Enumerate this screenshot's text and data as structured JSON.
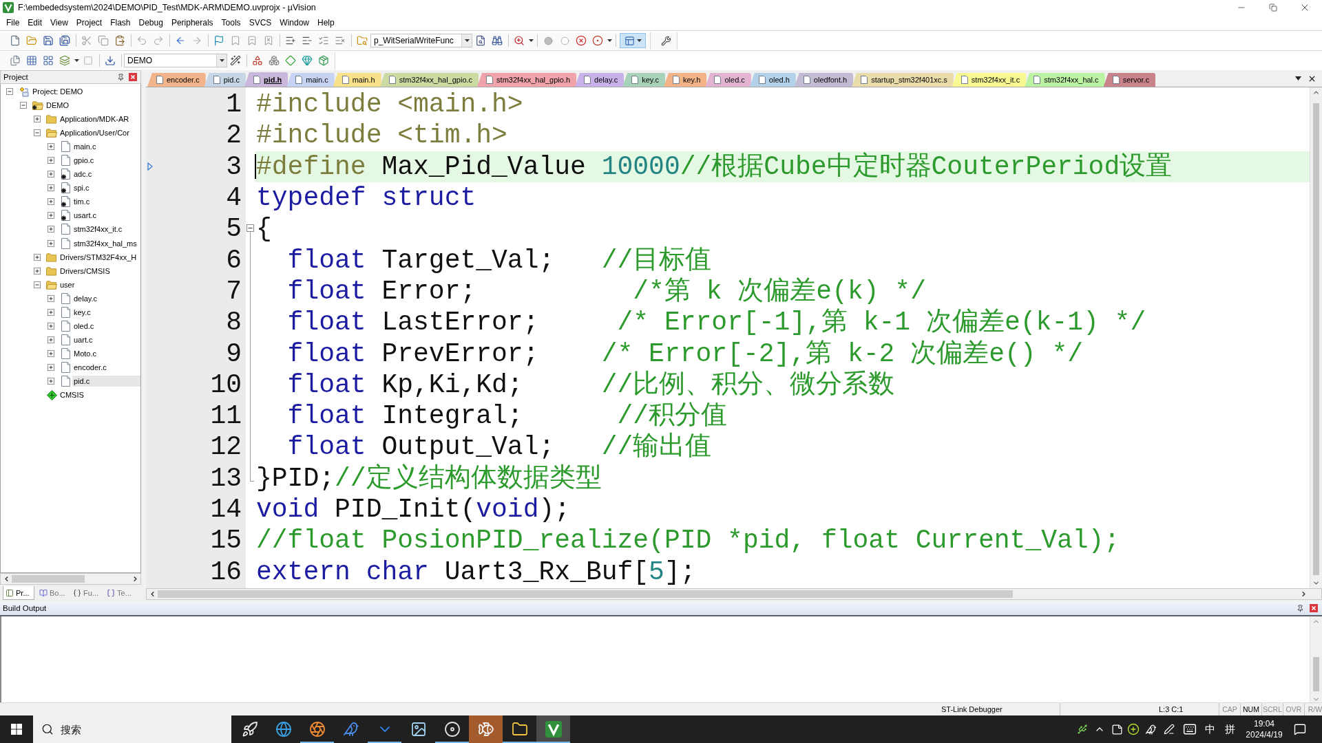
{
  "window": {
    "title": "F:\\embededsystem\\2024\\DEMO\\PID_Test\\MDK-ARM\\DEMO.uvprojx - µVision"
  },
  "menu": [
    "File",
    "Edit",
    "View",
    "Project",
    "Flash",
    "Debug",
    "Peripherals",
    "Tools",
    "SVCS",
    "Window",
    "Help"
  ],
  "toolbar": {
    "function_field": "p_WitSerialWriteFunc",
    "target_field": "DEMO"
  },
  "project_panel": {
    "title": "Project",
    "tree": [
      {
        "label": "Project: DEMO",
        "kind": "project",
        "expanded": true,
        "selected": false,
        "children": [
          {
            "label": "DEMO",
            "kind": "target",
            "expanded": true,
            "selected": false,
            "children": [
              {
                "label": "Application/MDK-AR",
                "kind": "group",
                "expanded": false,
                "selected": false
              },
              {
                "label": "Application/User/Cor",
                "kind": "group",
                "expanded": true,
                "selected": false,
                "children": [
                  {
                    "label": "main.c",
                    "kind": "file",
                    "expanded": false,
                    "selected": false
                  },
                  {
                    "label": "gpio.c",
                    "kind": "file",
                    "expanded": false,
                    "selected": false
                  },
                  {
                    "label": "adc.c",
                    "kind": "file_options",
                    "expanded": false,
                    "selected": false
                  },
                  {
                    "label": "spi.c",
                    "kind": "file_options",
                    "expanded": false,
                    "selected": false
                  },
                  {
                    "label": "tim.c",
                    "kind": "file_options",
                    "expanded": false,
                    "selected": false
                  },
                  {
                    "label": "usart.c",
                    "kind": "file_options",
                    "expanded": false,
                    "selected": false
                  },
                  {
                    "label": "stm32f4xx_it.c",
                    "kind": "file",
                    "expanded": false,
                    "selected": false
                  },
                  {
                    "label": "stm32f4xx_hal_ms",
                    "kind": "file",
                    "expanded": false,
                    "selected": false
                  }
                ]
              },
              {
                "label": "Drivers/STM32F4xx_H",
                "kind": "group",
                "expanded": false,
                "selected": false
              },
              {
                "label": "Drivers/CMSIS",
                "kind": "group",
                "expanded": false,
                "selected": false
              },
              {
                "label": "user",
                "kind": "group",
                "expanded": true,
                "selected": false,
                "children": [
                  {
                    "label": "delay.c",
                    "kind": "file",
                    "expanded": false,
                    "selected": false
                  },
                  {
                    "label": "key.c",
                    "kind": "file",
                    "expanded": false,
                    "selected": false
                  },
                  {
                    "label": "oled.c",
                    "kind": "file",
                    "expanded": false,
                    "selected": false
                  },
                  {
                    "label": "uart.c",
                    "kind": "file",
                    "expanded": false,
                    "selected": false
                  },
                  {
                    "label": "Moto.c",
                    "kind": "file",
                    "expanded": false,
                    "selected": false
                  },
                  {
                    "label": "encoder.c",
                    "kind": "file",
                    "expanded": false,
                    "selected": false
                  },
                  {
                    "label": "pid.c",
                    "kind": "file",
                    "expanded": false,
                    "selected": true
                  }
                ]
              },
              {
                "label": "CMSIS",
                "kind": "component",
                "selected": false
              }
            ]
          }
        ]
      }
    ]
  },
  "panel_tabs": [
    {
      "label": "Pr...",
      "selected": true
    },
    {
      "label": "Bo...",
      "selected": false
    },
    {
      "label": "Fu...",
      "selected": false
    },
    {
      "label": "Te...",
      "selected": false
    }
  ],
  "editor_tabs": [
    {
      "label": "encoder.c",
      "color": "#f2b48a",
      "selected": false
    },
    {
      "label": "pid.c",
      "color": "#c6d6e6",
      "selected": false
    },
    {
      "label": "pid.h",
      "color": "#c9b8dc",
      "selected": true
    },
    {
      "label": "main.c",
      "color": "#c7d3f2",
      "selected": false
    },
    {
      "label": "main.h",
      "color": "#f9e08a",
      "selected": false
    },
    {
      "label": "stm32f4xx_hal_gpio.c",
      "color": "#cbdba2",
      "selected": false
    },
    {
      "label": "stm32f4xx_hal_gpio.h",
      "color": "#f0a3ab",
      "selected": false
    },
    {
      "label": "delay.c",
      "color": "#c9b2ea",
      "selected": false
    },
    {
      "label": "key.c",
      "color": "#a9d2ba",
      "selected": false
    },
    {
      "label": "key.h",
      "color": "#f2b386",
      "selected": false
    },
    {
      "label": "oled.c",
      "color": "#e2b4d2",
      "selected": false
    },
    {
      "label": "oled.h",
      "color": "#b3d2ea",
      "selected": false
    },
    {
      "label": "oledfont.h",
      "color": "#c3bad3",
      "selected": false
    },
    {
      "label": "startup_stm32f401xc.s",
      "color": "#eadbaa",
      "selected": false
    },
    {
      "label": "stm32f4xx_it.c",
      "color": "#f8f992",
      "selected": false
    },
    {
      "label": "stm32f4xx_hal.c",
      "color": "#bcf2a4",
      "selected": false
    },
    {
      "label": "servor.c",
      "color": "#c9838b",
      "selected": false
    }
  ],
  "editor": {
    "lines": [
      {
        "number": "1",
        "current": false,
        "fold_start": false,
        "in_fold": false,
        "tokens": [
          {
            "kind": "preproc",
            "text": "#include <main.h>"
          }
        ]
      },
      {
        "number": "2",
        "current": false,
        "fold_start": false,
        "in_fold": false,
        "tokens": [
          {
            "kind": "preproc",
            "text": "#include <tim.h>"
          }
        ]
      },
      {
        "number": "3",
        "current": true,
        "fold_start": false,
        "in_fold": false,
        "tokens": [
          {
            "kind": "preproc",
            "text": "#define"
          },
          {
            "kind": "plain",
            "text": " Max_Pid_Value "
          },
          {
            "kind": "number",
            "text": "10000"
          },
          {
            "kind": "comment",
            "text": "//根据Cube中定时器CouterPeriod设置"
          }
        ]
      },
      {
        "number": "4",
        "current": false,
        "fold_start": false,
        "in_fold": false,
        "tokens": [
          {
            "kind": "keyword",
            "text": "typedef struct"
          }
        ]
      },
      {
        "number": "5",
        "current": false,
        "fold_start": true,
        "in_fold": false,
        "tokens": [
          {
            "kind": "plain",
            "text": "{"
          }
        ]
      },
      {
        "number": "6",
        "current": false,
        "fold_start": false,
        "in_fold": true,
        "tokens": [
          {
            "kind": "keyword",
            "text": "  float"
          },
          {
            "kind": "plain",
            "text": " Target_Val;   "
          },
          {
            "kind": "comment",
            "text": "//目标值"
          }
        ]
      },
      {
        "number": "7",
        "current": false,
        "fold_start": false,
        "in_fold": true,
        "tokens": [
          {
            "kind": "keyword",
            "text": "  float"
          },
          {
            "kind": "plain",
            "text": " Error;          "
          },
          {
            "kind": "comment",
            "text": "/*第 k 次偏差e(k) */"
          }
        ]
      },
      {
        "number": "8",
        "current": false,
        "fold_start": false,
        "in_fold": true,
        "tokens": [
          {
            "kind": "keyword",
            "text": "  float"
          },
          {
            "kind": "plain",
            "text": " LastError;     "
          },
          {
            "kind": "comment",
            "text": "/* Error[-1],第 k-1 次偏差e(k-1) */"
          }
        ]
      },
      {
        "number": "9",
        "current": false,
        "fold_start": false,
        "in_fold": true,
        "tokens": [
          {
            "kind": "keyword",
            "text": "  float"
          },
          {
            "kind": "plain",
            "text": " PrevError;    "
          },
          {
            "kind": "comment",
            "text": "/* Error[-2],第 k-2 次偏差e() */"
          }
        ]
      },
      {
        "number": "10",
        "current": false,
        "fold_start": false,
        "in_fold": true,
        "tokens": [
          {
            "kind": "keyword",
            "text": "  float"
          },
          {
            "kind": "plain",
            "text": " Kp,Ki,Kd;     "
          },
          {
            "kind": "comment",
            "text": "//比例、积分、微分系数"
          }
        ]
      },
      {
        "number": "11",
        "current": false,
        "fold_start": false,
        "in_fold": true,
        "tokens": [
          {
            "kind": "keyword",
            "text": "  float"
          },
          {
            "kind": "plain",
            "text": " Integral;      "
          },
          {
            "kind": "comment",
            "text": "//积分值"
          }
        ]
      },
      {
        "number": "12",
        "current": false,
        "fold_start": false,
        "in_fold": true,
        "tokens": [
          {
            "kind": "keyword",
            "text": "  float"
          },
          {
            "kind": "plain",
            "text": " Output_Val;   "
          },
          {
            "kind": "comment",
            "text": "//输出值"
          }
        ]
      },
      {
        "number": "13",
        "current": false,
        "fold_start": false,
        "in_fold": true,
        "tokens": [
          {
            "kind": "plain",
            "text": "}PID;"
          },
          {
            "kind": "comment",
            "text": "//定义结构体数据类型"
          }
        ]
      },
      {
        "number": "14",
        "current": false,
        "fold_start": false,
        "in_fold": false,
        "tokens": [
          {
            "kind": "keyword",
            "text": "void"
          },
          {
            "kind": "plain",
            "text": " PID_Init("
          },
          {
            "kind": "keyword",
            "text": "void"
          },
          {
            "kind": "plain",
            "text": ");"
          }
        ]
      },
      {
        "number": "15",
        "current": false,
        "fold_start": false,
        "in_fold": false,
        "tokens": [
          {
            "kind": "comment",
            "text": "//float PosionPID_realize(PID *pid, float Current_Val);"
          }
        ]
      },
      {
        "number": "16",
        "current": false,
        "fold_start": false,
        "in_fold": false,
        "tokens": [
          {
            "kind": "keyword",
            "text": "extern char"
          },
          {
            "kind": "plain",
            "text": " Uart3_Rx_Buf["
          },
          {
            "kind": "number",
            "text": "5"
          },
          {
            "kind": "plain",
            "text": "];"
          }
        ]
      }
    ]
  },
  "build_output": {
    "title": "Build Output"
  },
  "status_bar": {
    "debugger": "ST-Link Debugger",
    "position": "L:3 C:1",
    "indicators": [
      {
        "label": "CAP",
        "on": false
      },
      {
        "label": "NUM",
        "on": true
      },
      {
        "label": "SCRL",
        "on": false
      },
      {
        "label": "OVR",
        "on": false
      },
      {
        "label": "R/W",
        "on": false
      }
    ]
  },
  "taskbar": {
    "search": {
      "placeholder": "搜索"
    },
    "apps": [
      {
        "running": false,
        "selected": false,
        "attention": false
      },
      {
        "running": false,
        "selected": false,
        "attention": false
      },
      {
        "running": true,
        "selected": false,
        "attention": false
      },
      {
        "running": false,
        "selected": false,
        "attention": false
      },
      {
        "running": true,
        "selected": false,
        "attention": false
      },
      {
        "running": false,
        "selected": false,
        "attention": false
      },
      {
        "running": true,
        "selected": false,
        "attention": false
      },
      {
        "running": false,
        "selected": false,
        "attention": true
      },
      {
        "running": true,
        "selected": false,
        "attention": false
      },
      {
        "running": true,
        "selected": true,
        "attention": false
      }
    ],
    "tray": {
      "ime": "中",
      "ime_mode": "拼",
      "time": "19:04",
      "date": "2024/4/19"
    }
  }
}
